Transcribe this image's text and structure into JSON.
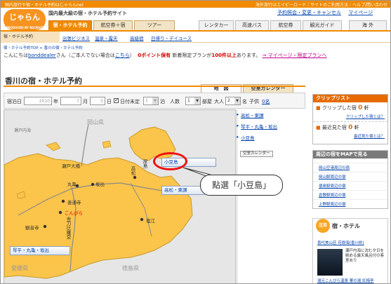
{
  "topbar": {
    "left_text": "国内旅行や宿・ホテル予約はじゃらんnet",
    "right_text": "海外旅行はエイビーロード｜サイトのご利用方法｜ヘルプ/問い合わせ"
  },
  "brand": {
    "logo_text": "じゃらん",
    "logo_sub": "PRODUCED BY RECRUIT",
    "tagline": "国内最大級の宿・ホテル予約サイト",
    "accent_color": "#f08a00"
  },
  "toplinks": [
    "予約照会・変更・キャンセル",
    "マイページ"
  ],
  "main_tabs": [
    "宿・ホテル予約",
    "航空券＋宿",
    "ツアー",
    "レンタカー",
    "高速バス",
    "航空券",
    "観光ガイド",
    "海 外"
  ],
  "subnav": {
    "home": "宿・ホテル予約",
    "items": [
      "出張ビジネス",
      "温泉・露天",
      "高級宿",
      "日帰り・デイユース"
    ]
  },
  "breadcrumb": "宿・ホテル予約TOP > 香川の宿・ホテル予約",
  "greeting": {
    "prefix": "こんにちは",
    "user": "bonddealer",
    "middle": "さん（ご本人でない場合は",
    "here_link": "こちら",
    "suffix": "）",
    "points": "0ポイント保有",
    "campaign_pre": "新着限定プランが",
    "campaign_count": "100件以上",
    "campaign_post": "あります。",
    "mypage_link": "→ マイページ・限定プランへ"
  },
  "page_title": "香川の宿・ホテル予約",
  "map_tabs": [
    "地　図",
    "空室カレンダー"
  ],
  "search": {
    "date_label": "宿泊日",
    "year": "2010",
    "year_unit": "年",
    "month": "7",
    "month_unit": "月",
    "day": "5",
    "day_unit": "日",
    "undecided_label": "日付未定",
    "nights": "1",
    "nights_unit": "泊",
    "people_label": "人数",
    "rooms": "1",
    "rooms_unit": "部屋",
    "adults_label": "大人",
    "adults": "2",
    "adults_unit": "名",
    "children_label": "子供",
    "children": "0名"
  },
  "map": {
    "prefectures": [
      "岡山県",
      "愛媛県",
      "徳島県"
    ],
    "sea_label": "瀬戸内海",
    "cities": [
      "瀬戸大橋",
      "丸亀",
      "坂出",
      "高松",
      "屋島",
      "善通寺",
      "こんぴら",
      "金刀比羅宮",
      "観音寺",
      "塩江"
    ],
    "area_buttons": [
      "小豆島",
      "高松・東讃",
      "琴平・丸亀・坂出"
    ]
  },
  "area_links": [
    "高松・東讃",
    "琴平・丸亀・坂出",
    "小豆島"
  ],
  "calendar_button": "空室カレンダー",
  "callout_text": "點選「小豆島」",
  "cliplist": {
    "header": "クリップリスト",
    "clipped_label": "クリップした宿",
    "clipped_count": "0",
    "clipped_unit": "軒",
    "clipped_link": "クリップした宿とは？",
    "recent_label": "最近見た宿",
    "recent_count": "0",
    "recent_unit": "軒",
    "recent_link": "最近見た宿とは？"
  },
  "nearby": {
    "header": "周辺の宿をMAPで見る",
    "links": [
      "岡山空港周辺の宿",
      "岡山駅周辺の宿",
      "徳島駅周辺の宿",
      "倉敷駅周辺の宿",
      "上野駅周辺の宿"
    ]
  },
  "hotel": {
    "badge": "注目",
    "title": "宿・ホテル",
    "name": "喜代美山荘 花樹海",
    "name_suffix": "[香川県]",
    "desc": "瀬戸内海に沈む夕日を眺める露天風呂付の客室あり",
    "bottom": "湯元こんぴら温泉 華の湯 紅梅亭"
  }
}
